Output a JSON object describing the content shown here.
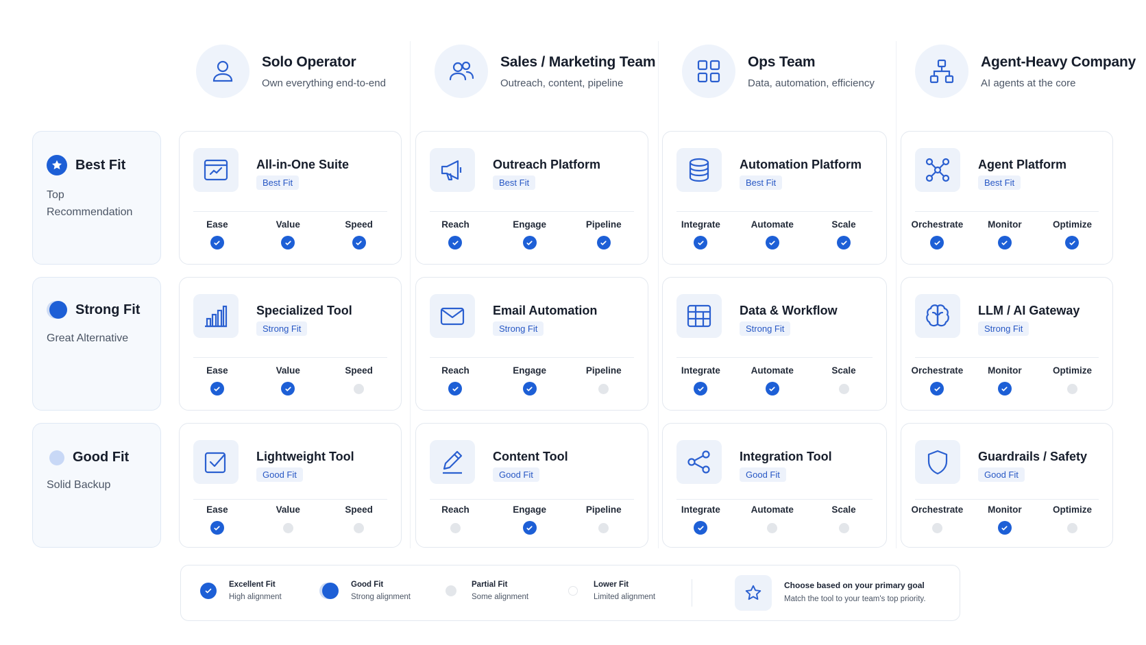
{
  "columns": [
    {
      "title": "Solo Operator",
      "subtitle": "Own everything end-to-end",
      "icon": "user-icon"
    },
    {
      "title": "Sales / Marketing Team",
      "subtitle": "Outreach, content, pipeline",
      "icon": "users-icon"
    },
    {
      "title": "Ops Team",
      "subtitle": "Data, automation, efficiency",
      "icon": "grid-icon"
    },
    {
      "title": "Agent-Heavy Company",
      "subtitle": "AI agents at the core",
      "icon": "org-chart-icon"
    }
  ],
  "rows": [
    {
      "title": "Best Fit",
      "subtitle": "Top Recommendation",
      "icon": "star-badge-icon"
    },
    {
      "title": "Strong Fit",
      "subtitle": "Great Alternative",
      "icon": "strong-dot-icon"
    },
    {
      "title": "Good Fit",
      "subtitle": "Solid Backup",
      "icon": "good-dot-icon"
    }
  ],
  "criteria": [
    [
      "Ease",
      "Value",
      "Speed"
    ],
    [
      "Reach",
      "Engage",
      "Pipeline"
    ],
    [
      "Integrate",
      "Automate",
      "Scale"
    ],
    [
      "Orchestrate",
      "Monitor",
      "Optimize"
    ]
  ],
  "cards": [
    [
      {
        "name": "All-in-One Suite",
        "tag": "Best Fit",
        "icon": "dashboard-icon",
        "checks": [
          true,
          true,
          true
        ]
      },
      {
        "name": "Outreach Platform",
        "tag": "Best Fit",
        "icon": "megaphone-icon",
        "checks": [
          true,
          true,
          true
        ]
      },
      {
        "name": "Automation Platform",
        "tag": "Best Fit",
        "icon": "database-icon",
        "checks": [
          true,
          true,
          true
        ]
      },
      {
        "name": "Agent Platform",
        "tag": "Best Fit",
        "icon": "network-icon",
        "checks": [
          true,
          true,
          true
        ]
      }
    ],
    [
      {
        "name": "Specialized Tool",
        "tag": "Strong Fit",
        "icon": "bar-chart-icon",
        "checks": [
          true,
          true,
          false
        ]
      },
      {
        "name": "Email Automation",
        "tag": "Strong Fit",
        "icon": "mail-icon",
        "checks": [
          true,
          true,
          false
        ]
      },
      {
        "name": "Data & Workflow",
        "tag": "Strong Fit",
        "icon": "table-icon",
        "checks": [
          true,
          true,
          false
        ]
      },
      {
        "name": "LLM / AI Gateway",
        "tag": "Strong Fit",
        "icon": "brain-icon",
        "checks": [
          true,
          true,
          false
        ]
      }
    ],
    [
      {
        "name": "Lightweight Tool",
        "tag": "Good Fit",
        "icon": "checkbox-icon",
        "checks": [
          true,
          false,
          false
        ]
      },
      {
        "name": "Content Tool",
        "tag": "Good Fit",
        "icon": "pencil-icon",
        "checks": [
          false,
          true,
          false
        ]
      },
      {
        "name": "Integration Tool",
        "tag": "Good Fit",
        "icon": "share-icon",
        "checks": [
          true,
          false,
          false
        ]
      },
      {
        "name": "Guardrails / Safety",
        "tag": "Good Fit",
        "icon": "shield-icon",
        "checks": [
          false,
          true,
          false
        ]
      }
    ]
  ],
  "legend": {
    "items": [
      {
        "label": "Excellent Fit",
        "sub": "High alignment"
      },
      {
        "label": "Good Fit",
        "sub": "Strong alignment"
      },
      {
        "label": "Partial Fit",
        "sub": "Some alignment"
      },
      {
        "label": "Lower Fit",
        "sub": "Limited alignment"
      }
    ],
    "goal_title": "Choose based on your primary goal",
    "goal_sub": "Match the tool to your team's top priority."
  },
  "colors": {
    "accent": "#1d5fd6",
    "tag_bg": "#edf2fb",
    "icon_bg": "#edf2fa",
    "off": "#e3e6ea"
  }
}
